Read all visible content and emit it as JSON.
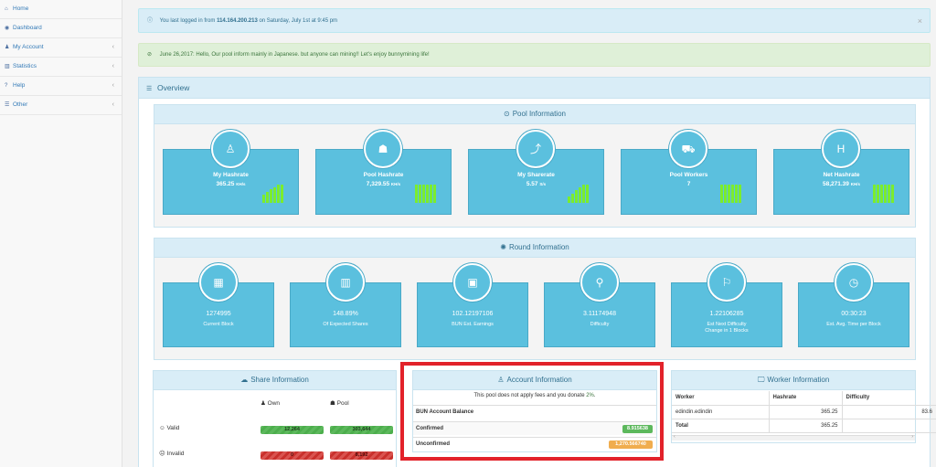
{
  "sidebar": {
    "items": [
      {
        "label": "Home",
        "icon": "home-icon",
        "glyph": "⌂",
        "chevron": ""
      },
      {
        "label": "Dashboard",
        "icon": "dashboard-icon",
        "glyph": "◉",
        "chevron": ""
      },
      {
        "label": "My Account",
        "icon": "user-icon",
        "glyph": "♟",
        "chevron": "‹"
      },
      {
        "label": "Statistics",
        "icon": "bar-chart-icon",
        "glyph": "▥",
        "chevron": "‹"
      },
      {
        "label": "Help",
        "icon": "question-icon",
        "glyph": "?",
        "chevron": "‹"
      },
      {
        "label": "Other",
        "icon": "list-icon",
        "glyph": "☰",
        "chevron": "‹"
      }
    ]
  },
  "alerts": {
    "login_prefix": "You last logged in from",
    "login_ip": "114.164.200.213",
    "login_suffix": "on Saturday, July 1st at 9:45 pm",
    "close": "×",
    "news": "June 26,2017: Hello, Our pool inform mainly in Japanese. but anyone can mining!! Let's enjoy bunnymining life!"
  },
  "overview": {
    "title": "Overview"
  },
  "pool": {
    "title": "Pool Information",
    "cards": [
      {
        "title": "My Hashrate",
        "value": "365.25",
        "unit": "KH/s",
        "glyph": "♙",
        "bars": true
      },
      {
        "title": "Pool Hashrate",
        "value": "7,329.55",
        "unit": "KH/s",
        "glyph": "☗",
        "bars": true
      },
      {
        "title": "My Sharerate",
        "value": "5.57",
        "unit": "S/s",
        "glyph": "⤴",
        "bars": true
      },
      {
        "title": "Pool Workers",
        "value": "7",
        "unit": "",
        "glyph": "⛟",
        "bars": true
      },
      {
        "title": "Net Hashrate",
        "value": "58,271.39",
        "unit": "KH/s",
        "glyph": "H",
        "bars": true
      }
    ]
  },
  "round": {
    "title": "Round Information",
    "cards": [
      {
        "value": "1274995",
        "label": "Current Block",
        "glyph": "▦"
      },
      {
        "value": "148.89%",
        "label": "Of Expected Shares",
        "glyph": "▥"
      },
      {
        "value": "102.12197106",
        "label": "BUN Est. Earnings",
        "glyph": "▣"
      },
      {
        "value": "3.11174948",
        "label": "Difficulty",
        "glyph": "⚲"
      },
      {
        "value": "1.22106285",
        "label": "Est Next Difficulty",
        "label2": "Change in 1 Blocks",
        "glyph": "⚐"
      },
      {
        "value": "00:30:23",
        "label": "Est. Avg. Time per Block",
        "glyph": "◷"
      }
    ]
  },
  "share": {
    "title": "Share Information",
    "col_own": "Own",
    "col_pool": "Pool",
    "rows": [
      {
        "label": "Valid",
        "own": "12,264",
        "pool": "303,644"
      },
      {
        "label": "Invalid",
        "own": "0",
        "pool": "8,192"
      }
    ]
  },
  "account": {
    "title": "Account Information",
    "fee_note": "This pool does not apply fees and you donate",
    "donate": "2%",
    "balance_title": "BUN Account Balance",
    "confirmed_label": "Confirmed",
    "confirmed_value": "8.915638",
    "unconfirmed_label": "Unconfirmed",
    "unconfirmed_value": "1,270.566740"
  },
  "worker": {
    "title": "Worker Information",
    "headers": [
      "Worker",
      "Hashrate",
      "Difficulty"
    ],
    "rows": [
      {
        "worker": "edindin.edindin",
        "hashrate": "365.25",
        "difficulty": "83.6"
      },
      {
        "worker": "Total",
        "hashrate": "365.25",
        "difficulty": ""
      }
    ]
  },
  "colors": {
    "card": "#5bc0de",
    "accent": "#31708f",
    "bars": "#7bed2d",
    "highlight": "#e2222a"
  }
}
